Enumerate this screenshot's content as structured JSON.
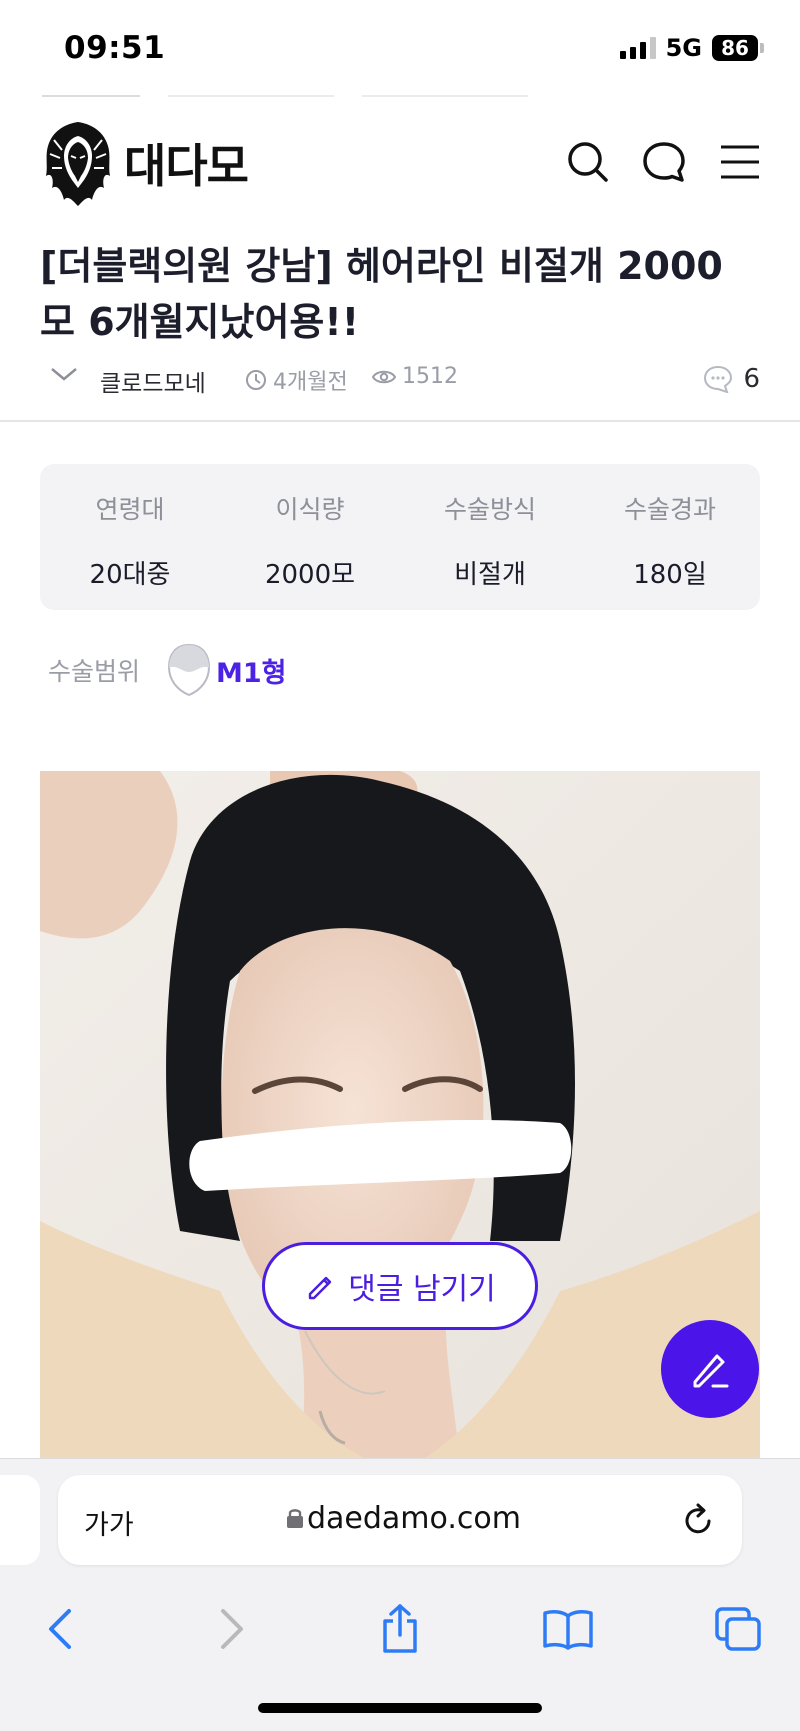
{
  "status_bar": {
    "time": "09:51",
    "network": "5G",
    "battery": "86"
  },
  "header": {
    "logo_text": "대다모"
  },
  "post": {
    "title": "[더블랙의원 강남] 헤어라인 비절개 2000모 6개월지났어용!!",
    "author": "클로드모네",
    "time_ago": "4개월전",
    "views": "1512",
    "comment_count": "6"
  },
  "info": {
    "columns": [
      {
        "head": "연령대",
        "value": "20대중"
      },
      {
        "head": "이식량",
        "value": "2000모"
      },
      {
        "head": "수술방식",
        "value": "비절개"
      },
      {
        "head": "수술경과",
        "value": "180일"
      }
    ]
  },
  "surgery_range": {
    "label": "수술범위",
    "value": "M1형"
  },
  "actions": {
    "comment_button": "댓글 남기기"
  },
  "browser": {
    "aa_label": "가가",
    "url": "daedamo.com"
  },
  "colors": {
    "accent": "#4b14e8",
    "text": "#1b1c2a",
    "muted": "#9a9ca6",
    "panel": "#f3f3f5"
  }
}
